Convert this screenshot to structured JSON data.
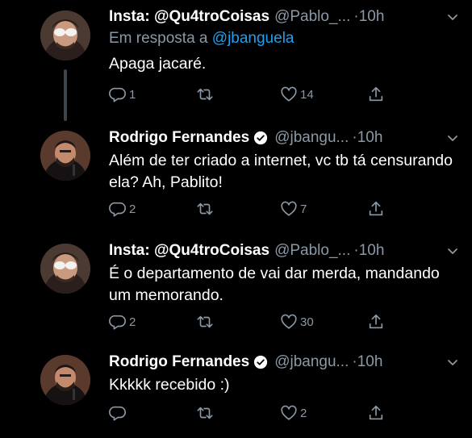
{
  "tweets": [
    {
      "name": "Insta: @Qu4troCoisas",
      "handle": "@Pablo_...",
      "time": "10h",
      "reply_prefix": "Em resposta a ",
      "reply_to": "@jbanguela",
      "text": "Apaga jacaré.",
      "replies": "1",
      "retweets": "",
      "likes": "14"
    },
    {
      "name": "Rodrigo Fernandes",
      "handle": "@jbangu...",
      "time": "10h",
      "text": "Além de ter criado a internet, vc tb tá censurando ela? Ah, Pablito!",
      "replies": "2",
      "retweets": "",
      "likes": "7"
    },
    {
      "name": "Insta: @Qu4troCoisas",
      "handle": "@Pablo_...",
      "time": "10h",
      "text": "É o departamento de vai dar merda, mandando um memorando.",
      "replies": "2",
      "retweets": "",
      "likes": "30"
    },
    {
      "name": "Rodrigo Fernandes",
      "handle": "@jbangu...",
      "time": "10h",
      "text": "Kkkkk recebido :)",
      "replies": "",
      "retweets": "",
      "likes": "2"
    }
  ],
  "separator": "·",
  "colors": {
    "background": "#000000",
    "text": "#ffffff",
    "secondary": "#8b98a5",
    "link": "#1da1f2",
    "thread_line": "#3d444c",
    "verified": "#ffffff"
  },
  "icons": {
    "reply": "reply-icon",
    "retweet": "retweet-icon",
    "like": "heart-icon",
    "share": "share-icon",
    "menu": "chevron-down-icon",
    "verified": "verified-badge-icon"
  }
}
